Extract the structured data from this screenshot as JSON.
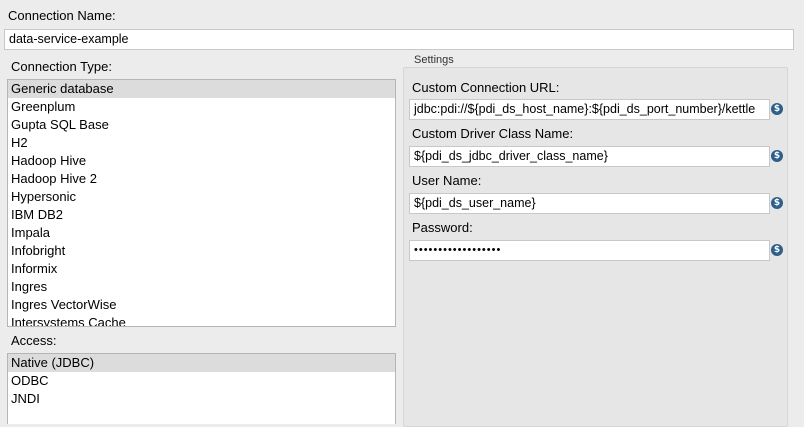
{
  "connection_name": {
    "label": "Connection Name:",
    "value": "data-service-example"
  },
  "connection_type": {
    "label": "Connection Type:",
    "items": [
      "Generic database",
      "Greenplum",
      "Gupta SQL Base",
      "H2",
      "Hadoop Hive",
      "Hadoop Hive 2",
      "Hypersonic",
      "IBM DB2",
      "Impala",
      "Infobright",
      "Informix",
      "Ingres",
      "Ingres VectorWise",
      "Intersystems Cache"
    ],
    "selected": "Generic database"
  },
  "access": {
    "label": "Access:",
    "items": [
      "Native (JDBC)",
      "ODBC",
      "JNDI"
    ],
    "selected": "Native (JDBC)"
  },
  "settings": {
    "title": "Settings",
    "custom_url": {
      "label": "Custom Connection URL:",
      "value": "jdbc:pdi://${pdi_ds_host_name}:${pdi_ds_port_number}/kettle"
    },
    "driver_class": {
      "label": "Custom Driver Class Name:",
      "value": "${pdi_ds_jdbc_driver_class_name}"
    },
    "user_name": {
      "label": "User Name:",
      "value": "${pdi_ds_user_name}"
    },
    "password": {
      "label": "Password:",
      "value": "••••••••••••••••••"
    },
    "variable_icon": "variable-dollar-icon",
    "variable_icon_glyph": "$"
  },
  "colors": {
    "selection": "#dcdcdc",
    "icon": "#2e5f8a",
    "background": "#ececec"
  }
}
